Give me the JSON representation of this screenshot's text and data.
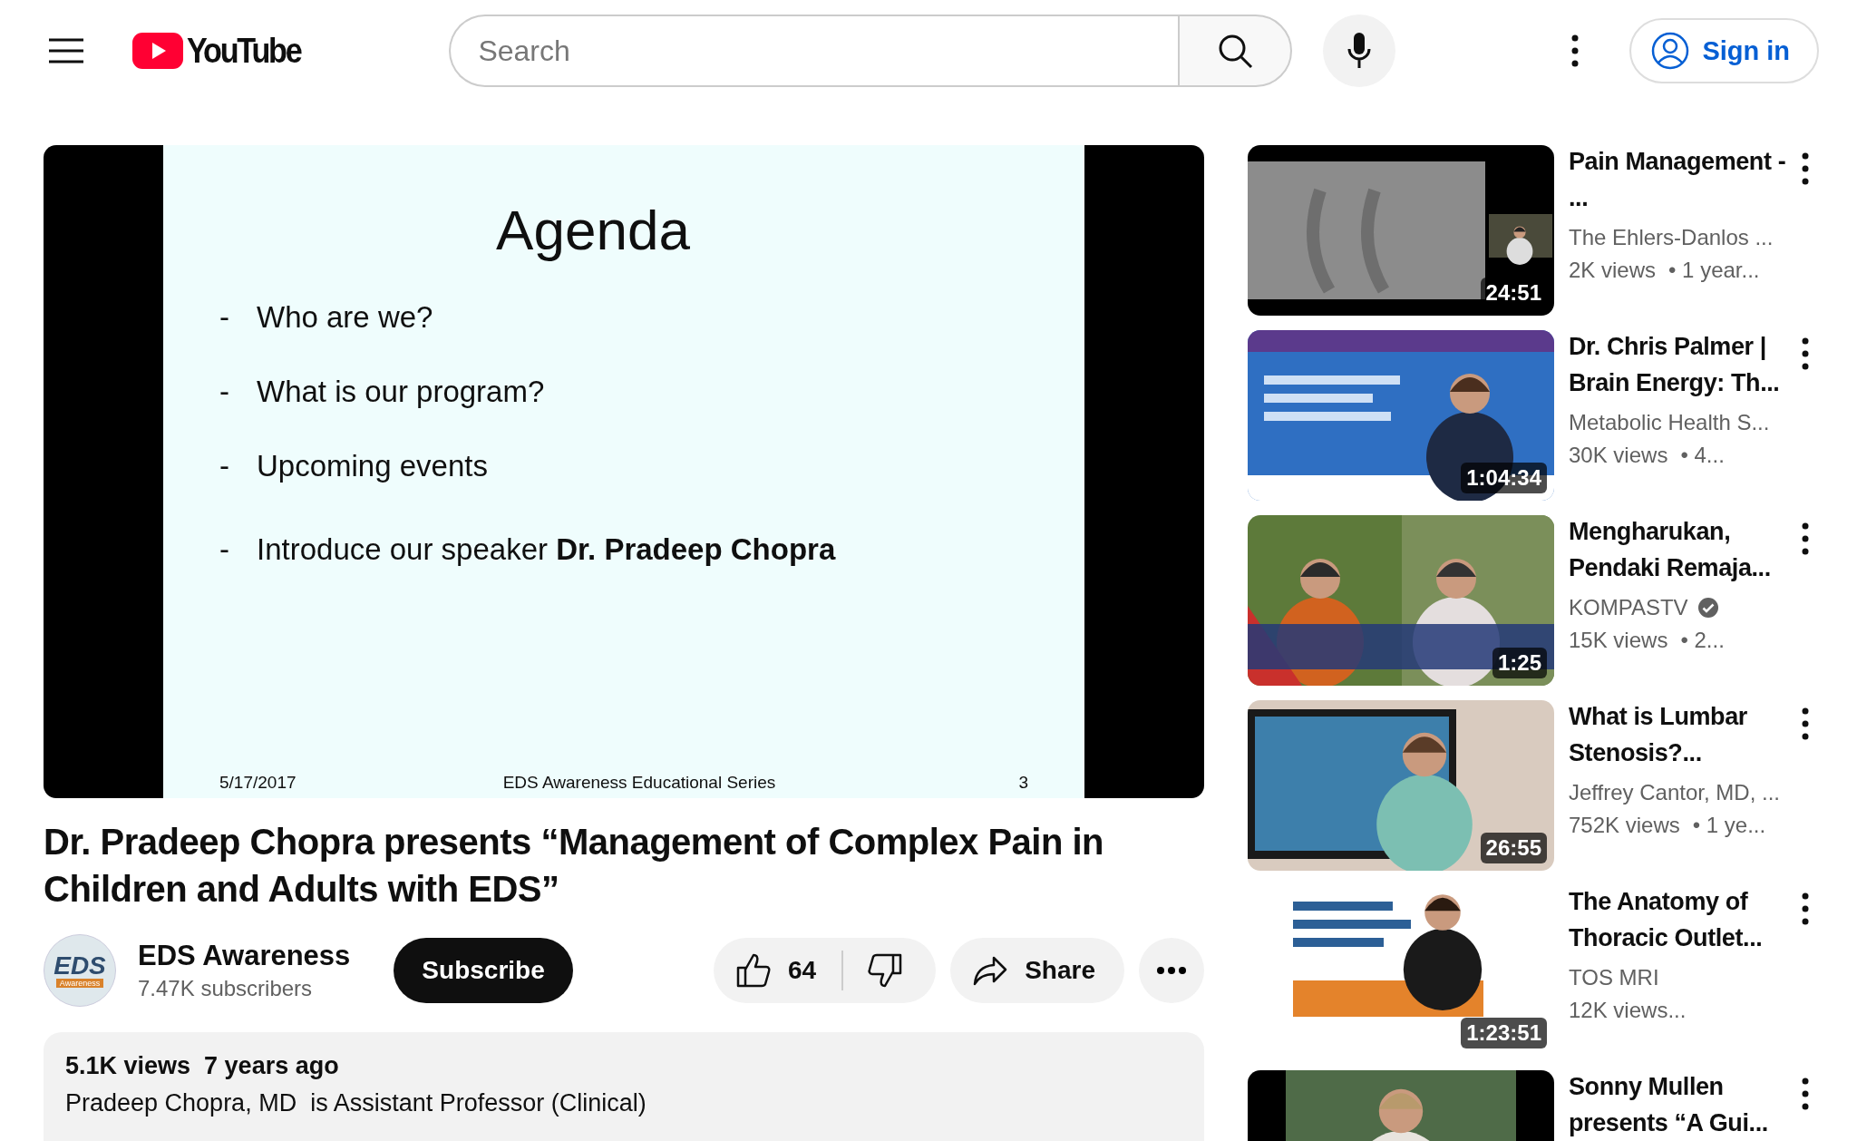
{
  "header": {
    "logo": "YouTube",
    "search": {
      "placeholder": "Search"
    },
    "sign_in": "Sign in"
  },
  "video": {
    "slide": {
      "title": "Agenda",
      "bullets": [
        {
          "marker": "-",
          "text": "Who are we?"
        },
        {
          "marker": "-",
          "text": "What is our program?"
        },
        {
          "marker": "-",
          "text": "Upcoming events"
        },
        {
          "marker": "-",
          "text": "Introduce our speaker **Dr. Pradeep Chopra**"
        }
      ],
      "footer_date": "5/17/2017",
      "footer_center": "EDS Awareness Educational Series",
      "footer_page": "3"
    }
  },
  "title": "Dr. Pradeep Chopra presents “Management of Complex Pain in Children and Adults with EDS”",
  "channel": {
    "avatar": "EDS",
    "avatar_tag": "Awareness",
    "name": "EDS Awareness",
    "subscribers": "7.47K subscribers",
    "subscribe": "Subscribe"
  },
  "actions": {
    "likes": "64",
    "share": "Share"
  },
  "description": {
    "stats": "5.1K views  7 years ago",
    "text": "Pradeep Chopra, MD  is Assistant Professor (Clinical)"
  },
  "related": [
    {
      "title": "Pain Management - ...",
      "channel": "The Ehlers-Danlos ...",
      "verified": false,
      "views": "2K views",
      "age": "• 1 year...",
      "duration": "24:51"
    },
    {
      "title": "Dr. Chris Palmer | Brain Energy: Th...",
      "channel": "Metabolic Health S...",
      "verified": false,
      "views": "30K views",
      "age": "• 4...",
      "duration": "1:04:34"
    },
    {
      "title": "Mengharukan, Pendaki Remaja...",
      "channel": "KOMPASTV",
      "verified": true,
      "views": "15K views",
      "age": "• 2...",
      "duration": "1:25"
    },
    {
      "title": "What is Lumbar Stenosis?...",
      "channel": "Jeffrey Cantor, MD, ...",
      "verified": false,
      "views": "752K views",
      "age": "• 1 ye...",
      "duration": "26:55"
    },
    {
      "title": "The Anatomy of Thoracic Outlet...",
      "channel": "TOS MRI",
      "verified": false,
      "views": "12K views...",
      "duration": "1:23:51"
    },
    {
      "title": "Sonny Mullen presents “A Gui...",
      "verified": false
    }
  ]
}
